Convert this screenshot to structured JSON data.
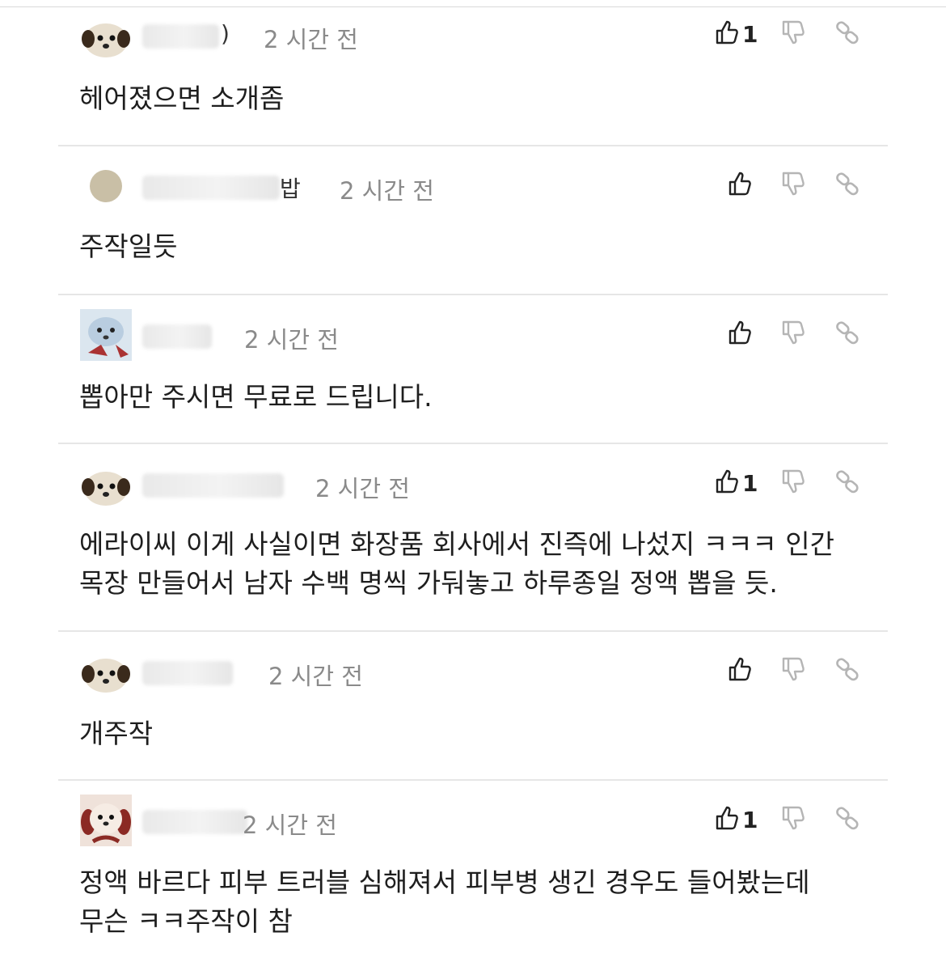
{
  "comments": [
    {
      "time": "2 시간 전",
      "name_visible": ")",
      "likes": "1",
      "lines": [
        "헤어졌으면 소개좀"
      ]
    },
    {
      "time": "2 시간 전",
      "name_visible": "밥",
      "likes": "",
      "lines": [
        "주작일듯"
      ]
    },
    {
      "time": "2 시간 전",
      "name_visible": "",
      "likes": "",
      "lines": [
        "뽑아만 주시면 무료로 드립니다."
      ]
    },
    {
      "time": "2 시간 전",
      "name_visible": "",
      "likes": "1",
      "lines": [
        "에라이씨 이게 사실이면 화장품 회사에서 진즉에 나섰지 ㅋㅋㅋ 인간",
        "목장 만들어서 남자 수백 명씩 가둬놓고 하루종일 정액 뽑을 듯."
      ]
    },
    {
      "time": "2 시간 전",
      "name_visible": "",
      "likes": "",
      "lines": [
        "개주작"
      ]
    },
    {
      "time": "2 시간 전",
      "name_visible": "",
      "likes": "1",
      "lines": [
        "정액 바르다 피부 트러블 심해져서 피부병 생긴 경우도 들어봤는데",
        "무슨 ㅋㅋ주작이 참"
      ]
    }
  ],
  "icons": {
    "like": "thumbs-up-icon",
    "dislike": "thumbs-down-icon",
    "link": "link-icon"
  },
  "colors": {
    "text": "#1e1e1e",
    "time": "#8a8a8a",
    "icon": "#222222",
    "icon_muted": "#b5b5b5",
    "divider": "#e6e6e6"
  }
}
